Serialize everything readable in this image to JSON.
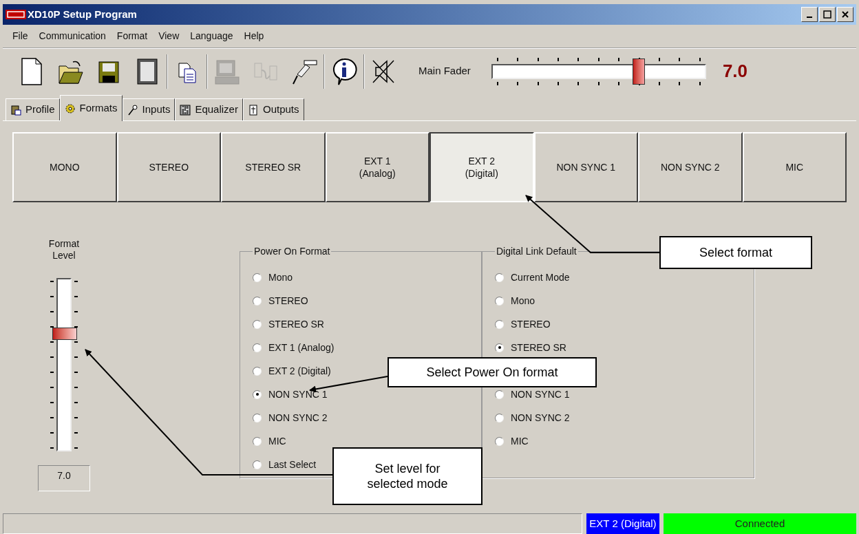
{
  "window": {
    "title": "XD10P Setup Program"
  },
  "menu": [
    "File",
    "Communication",
    "Format",
    "View",
    "Language",
    "Help"
  ],
  "toolbar": [
    {
      "kind": "new",
      "disabled": false
    },
    {
      "kind": "open",
      "disabled": false
    },
    {
      "kind": "save",
      "disabled": false
    },
    {
      "kind": "frame",
      "disabled": false
    },
    {
      "kind": "copy",
      "disabled": false
    },
    {
      "kind": "computer",
      "disabled": true
    },
    {
      "kind": "link",
      "disabled": true
    },
    {
      "kind": "cable",
      "disabled": false
    },
    {
      "kind": "info",
      "disabled": false
    },
    {
      "kind": "mute",
      "disabled": false
    }
  ],
  "main_fader": {
    "label": "Main Fader",
    "level": 0.69,
    "reading": "7.0"
  },
  "tabs": [
    {
      "label": "Profile",
      "kind": "profile",
      "selected": false
    },
    {
      "label": "Formats",
      "kind": "formats",
      "selected": true
    },
    {
      "label": "Inputs",
      "kind": "inputs",
      "selected": false
    },
    {
      "label": "Equalizer",
      "kind": "equalizer",
      "selected": false
    },
    {
      "label": "Outputs",
      "kind": "outputs",
      "selected": false
    }
  ],
  "formats": [
    {
      "lines": [
        "MONO"
      ],
      "selected": false
    },
    {
      "lines": [
        "STEREO"
      ],
      "selected": false
    },
    {
      "lines": [
        "STEREO SR"
      ],
      "selected": false
    },
    {
      "lines": [
        "EXT 1",
        "(Analog)"
      ],
      "selected": false
    },
    {
      "lines": [
        "EXT 2",
        "(Digital)"
      ],
      "selected": true
    },
    {
      "lines": [
        "NON SYNC 1"
      ],
      "selected": false
    },
    {
      "lines": [
        "NON SYNC 2"
      ],
      "selected": false
    },
    {
      "lines": [
        "MIC"
      ],
      "selected": false
    }
  ],
  "format_level": {
    "label": [
      "Format",
      "Level"
    ],
    "level": 0.68,
    "reading": "7.0"
  },
  "power_on_format": {
    "title": "Power On Format",
    "options": [
      {
        "label": "Mono",
        "selected": false
      },
      {
        "label": "STEREO",
        "selected": false
      },
      {
        "label": "STEREO SR",
        "selected": false
      },
      {
        "label": "EXT 1 (Analog)",
        "selected": false
      },
      {
        "label": "EXT 2 (Digital)",
        "selected": false
      },
      {
        "label": "NON SYNC 1",
        "selected": true
      },
      {
        "label": "NON SYNC 2",
        "selected": false
      },
      {
        "label": "MIC",
        "selected": false
      },
      {
        "label": "Last Select",
        "selected": false
      }
    ]
  },
  "digital_link_default": {
    "title": "Digital Link Default",
    "options": [
      {
        "label": "Current Mode",
        "selected": false
      },
      {
        "label": "Mono",
        "selected": false
      },
      {
        "label": "STEREO",
        "selected": false
      },
      {
        "label": "STEREO SR",
        "selected": true
      },
      {
        "label": "NON SYNC 1",
        "selected": false
      },
      {
        "label": "NON SYNC 2",
        "selected": false
      },
      {
        "label": "MIC",
        "selected": false
      }
    ]
  },
  "callouts": [
    {
      "text": "Select format"
    },
    {
      "text": "Select Power On format"
    },
    {
      "text": "Set level for selected mode"
    }
  ],
  "status_bar": [
    {
      "text": "EXT 2 (Digital)",
      "color": "#0000ff"
    },
    {
      "text": "Connected",
      "color": "#00ff00"
    }
  ]
}
